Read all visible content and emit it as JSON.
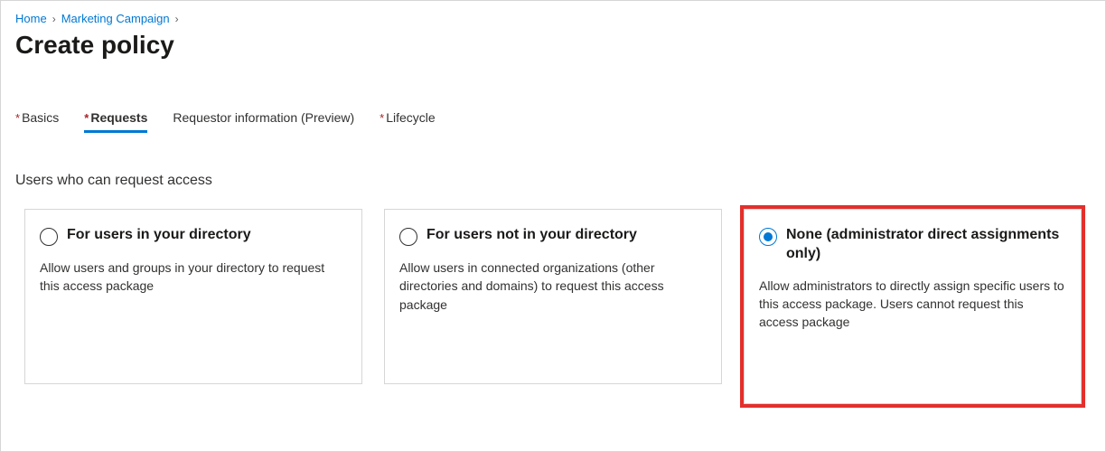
{
  "breadcrumb": {
    "items": [
      "Home",
      "Marketing Campaign"
    ]
  },
  "page_title": "Create policy",
  "tabs": {
    "items": [
      {
        "label": "Basics",
        "required": true,
        "active": false
      },
      {
        "label": "Requests",
        "required": true,
        "active": true
      },
      {
        "label": "Requestor information (Preview)",
        "required": false,
        "active": false
      },
      {
        "label": "Lifecycle",
        "required": true,
        "active": false
      }
    ]
  },
  "section_heading": "Users who can request access",
  "cards": [
    {
      "title": "For users in your directory",
      "description": "Allow users and groups in your directory to request this access package",
      "selected": false
    },
    {
      "title": "For users not in your directory",
      "description": "Allow users in connected organizations (other directories and domains) to request this access package",
      "selected": false
    },
    {
      "title": "None (administrator direct assignments only)",
      "description": "Allow administrators to directly assign specific users to this access package. Users cannot request this access package",
      "selected": true
    }
  ]
}
